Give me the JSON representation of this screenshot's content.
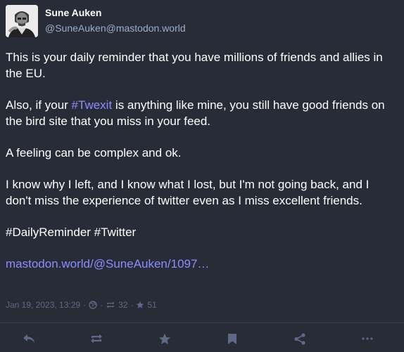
{
  "author": {
    "display_name": "Sune Auken",
    "handle": "@SuneAuken@mastodon.world"
  },
  "post": {
    "p1": "This is your daily reminder that you have millions of friends and allies in the EU.",
    "p2_before": "Also, if your ",
    "p2_hashtag": "#Twexit",
    "p2_after": " is anything like mine, you still have good friends on the bird site that you miss in your feed.",
    "p3": "A feeling can be complex and ok.",
    "p4": "I know why I left, and I know what I lost, but I'm not going back, and I don't miss the experience of twitter even as I miss excellent friends.",
    "tag1": "#DailyReminder",
    "tag2": "#Twitter",
    "link": "mastodon.world/@SuneAuken/1097…"
  },
  "meta": {
    "timestamp": "Jan 19, 2023, 13:29",
    "sep": "·",
    "visibility_icon": "globe-icon",
    "boosts": "32",
    "favourites": "51"
  },
  "actions": [
    "reply-icon",
    "boost-icon",
    "favourite-icon",
    "bookmark-icon",
    "share-icon",
    "more-icon"
  ],
  "colors": {
    "background": "#282c37",
    "text": "#ffffff",
    "handle": "#9baec8",
    "link": "#8c8dff",
    "meta": "#606984",
    "icon": "#606984"
  }
}
